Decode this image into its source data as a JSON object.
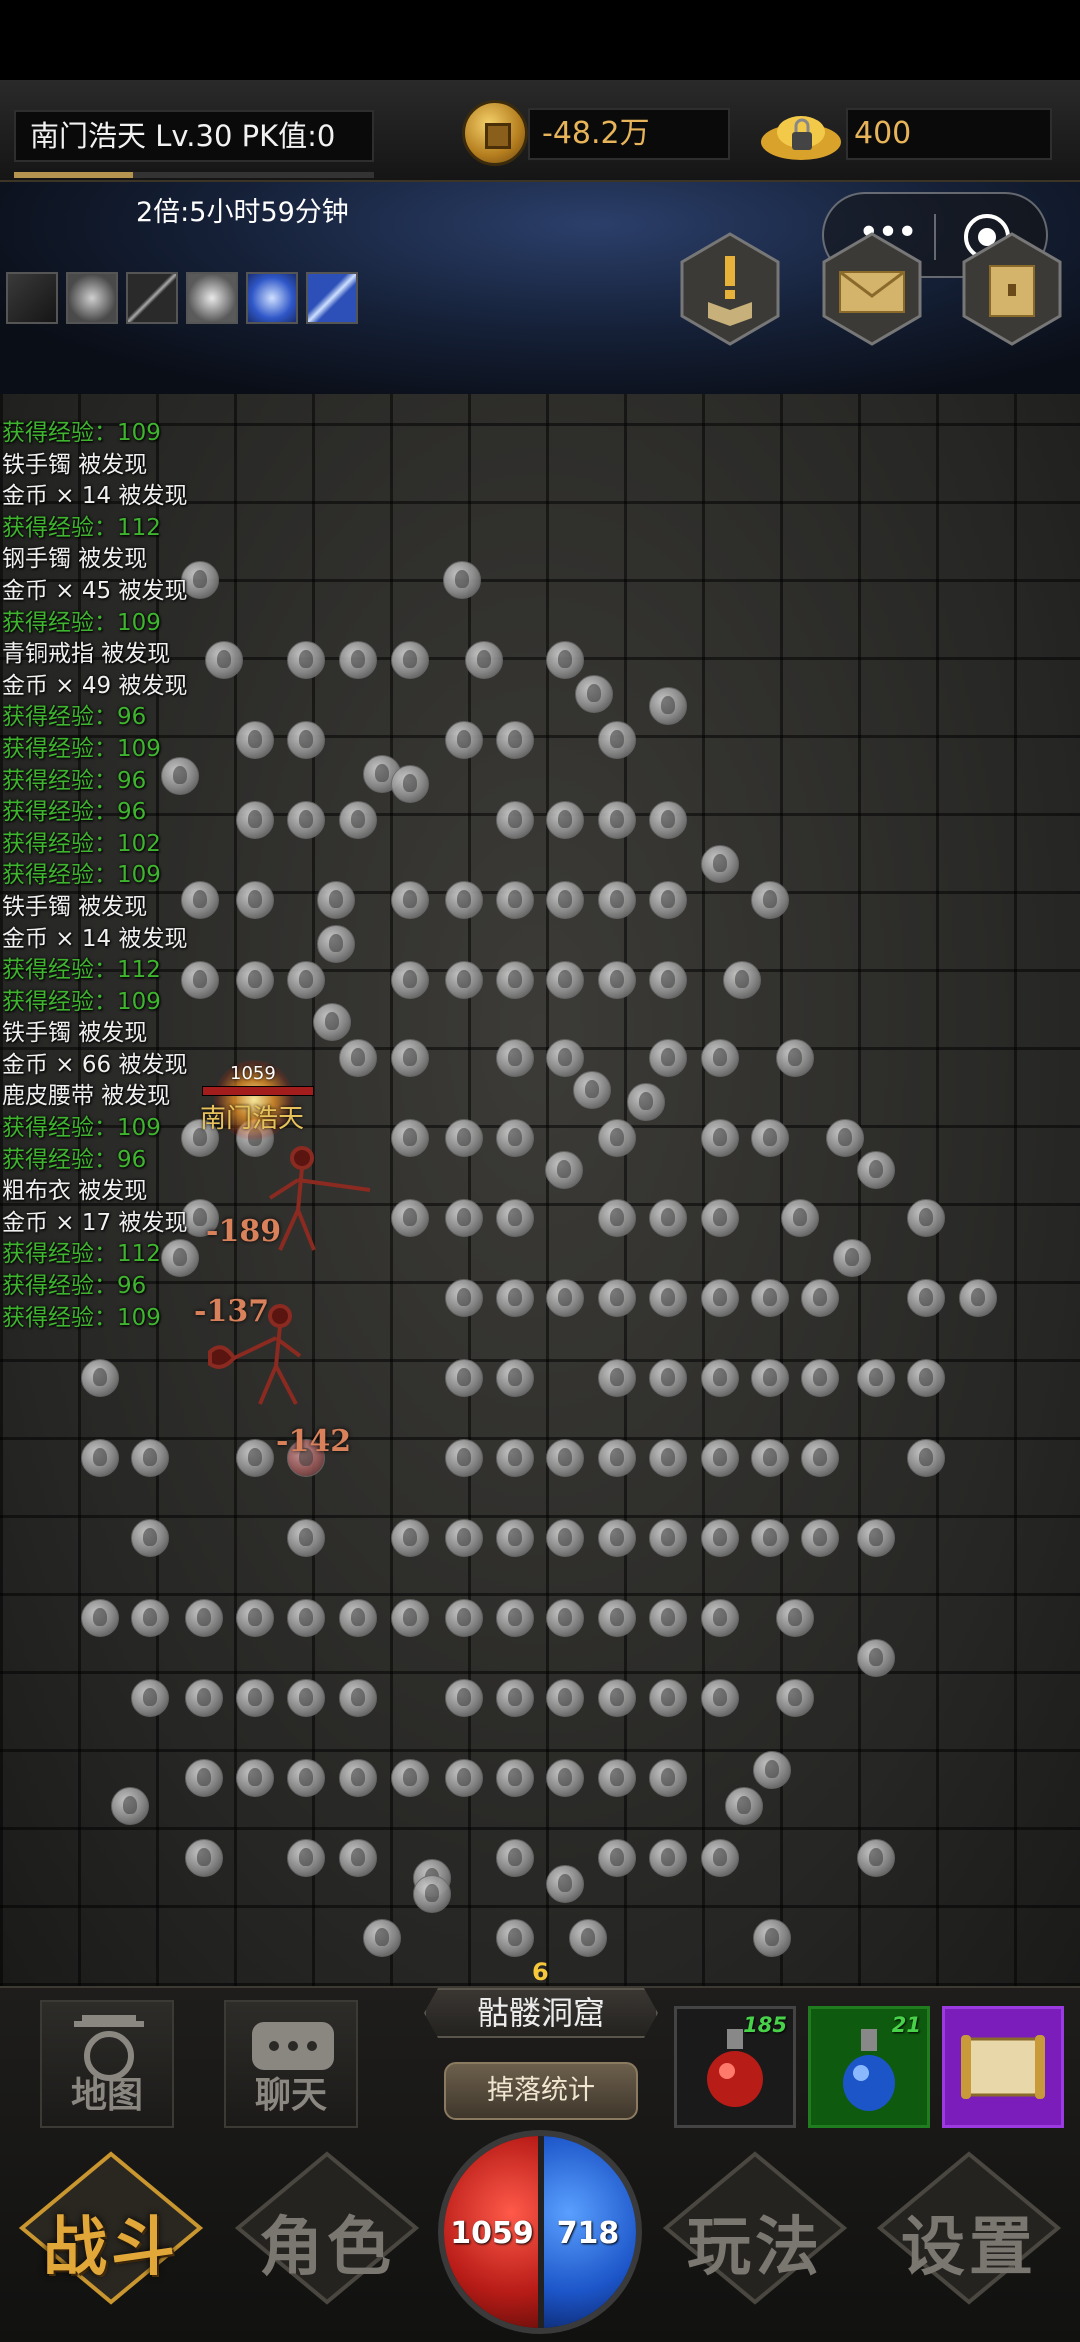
{
  "player": {
    "name_line": "南门浩天  Lv.30 PK值:0",
    "exp_fraction": 0.33,
    "overhead_name": "南门浩天",
    "overhead_hp": "1059"
  },
  "currency": {
    "gold": "-48.2万",
    "ingot": "400"
  },
  "buff": {
    "multiplier_text": "2倍:5小时59分钟"
  },
  "skills": [
    {
      "icon": "slash-skill-icon"
    },
    {
      "icon": "flame-skill-icon"
    },
    {
      "icon": "sword-skill-icon"
    },
    {
      "icon": "fire-burst-skill-icon"
    },
    {
      "icon": "skull-skill-icon"
    },
    {
      "icon": "blade-skill-icon"
    }
  ],
  "capsule": {
    "more": "•••"
  },
  "battle_log": [
    {
      "text": "获得经验：109",
      "type": "exp"
    },
    {
      "text": "铁手镯 被发现",
      "type": "item"
    },
    {
      "text": "金币 × 14 被发现",
      "type": "item"
    },
    {
      "text": "获得经验：112",
      "type": "exp"
    },
    {
      "text": "钢手镯 被发现",
      "type": "item"
    },
    {
      "text": "金币 × 45 被发现",
      "type": "item"
    },
    {
      "text": "获得经验：109",
      "type": "exp"
    },
    {
      "text": "青铜戒指 被发现",
      "type": "item"
    },
    {
      "text": "金币 × 49 被发现",
      "type": "item"
    },
    {
      "text": "获得经验：96",
      "type": "exp"
    },
    {
      "text": "获得经验：109",
      "type": "exp"
    },
    {
      "text": "获得经验：96",
      "type": "exp"
    },
    {
      "text": "获得经验：96",
      "type": "exp"
    },
    {
      "text": "获得经验：102",
      "type": "exp"
    },
    {
      "text": "获得经验：109",
      "type": "exp"
    },
    {
      "text": "铁手镯 被发现",
      "type": "item"
    },
    {
      "text": "金币 × 14 被发现",
      "type": "item"
    },
    {
      "text": "获得经验：112",
      "type": "exp"
    },
    {
      "text": "获得经验：109",
      "type": "exp"
    },
    {
      "text": "铁手镯 被发现",
      "type": "item"
    },
    {
      "text": "金币 × 66 被发现",
      "type": "item"
    },
    {
      "text": "鹿皮腰带 被发现",
      "type": "item"
    },
    {
      "text": "获得经验：109",
      "type": "exp"
    },
    {
      "text": "获得经验：96",
      "type": "exp"
    },
    {
      "text": "粗布衣 被发现",
      "type": "item"
    },
    {
      "text": "金币 × 17 被发现",
      "type": "item"
    },
    {
      "text": "获得经验：112",
      "type": "exp"
    },
    {
      "text": "获得经验：96",
      "type": "exp"
    },
    {
      "text": "获得经验：109",
      "type": "exp"
    }
  ],
  "damage_numbers": [
    "-189",
    "-137",
    "-142"
  ],
  "map": {
    "count": "6",
    "name": "骷髅洞窟",
    "drop_stats": "掉落统计"
  },
  "hud": {
    "map_label": "地图",
    "chat_label": "聊天"
  },
  "potions": {
    "red_count": "185",
    "blue_count": "21"
  },
  "globe": {
    "hp": "1059",
    "mp": "718"
  },
  "tabs": {
    "battle": "战斗",
    "character": "角色",
    "gameplay": "玩法",
    "settings": "设置"
  },
  "colors": {
    "exp_text": "#3fb52f",
    "item_text": "#f0f0f0",
    "gold_text": "#e7b45a",
    "active_tab": "#e2a739"
  }
}
